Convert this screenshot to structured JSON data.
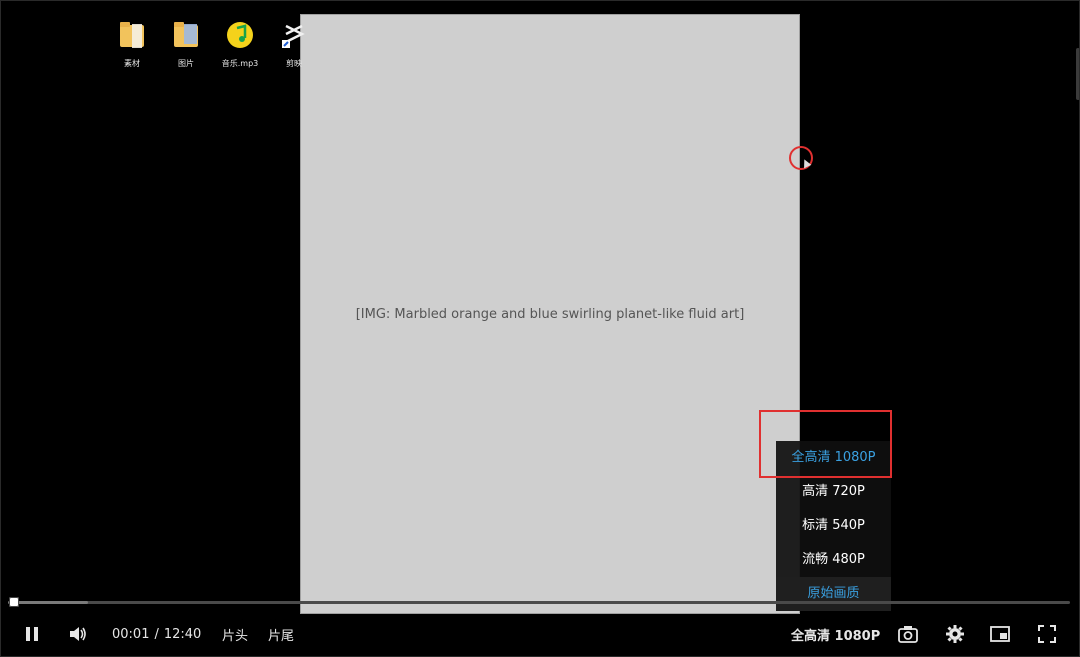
{
  "desktop": {
    "icons": [
      {
        "label": "素材",
        "icon": "folder-icon"
      },
      {
        "label": "图片",
        "icon": "folder-icon"
      },
      {
        "label": "音乐.mp3",
        "icon": "music-file-icon"
      },
      {
        "label": "剪映",
        "icon": "capcut-shortcut-icon"
      }
    ]
  },
  "video": {
    "image_placeholder": "[IMG: Marbled orange and blue swirling planet-like fluid art]"
  },
  "player": {
    "current_time": "00:01",
    "separator": "/",
    "duration": "12:40",
    "progress_fraction": 0.0013,
    "intro_label": "片头",
    "outro_label": "片尾",
    "quality_current": "全高清 1080P",
    "quality_options": [
      {
        "label": "全高清 1080P",
        "active": true
      },
      {
        "label": "高清 720P",
        "active": false
      },
      {
        "label": "标清 540P",
        "active": false
      },
      {
        "label": "流畅 480P",
        "active": false
      },
      {
        "label": "原始画质",
        "active": false
      }
    ]
  },
  "colors": {
    "accent": "#3aa0e0",
    "annotation": "#e03030",
    "background": "#000000"
  }
}
